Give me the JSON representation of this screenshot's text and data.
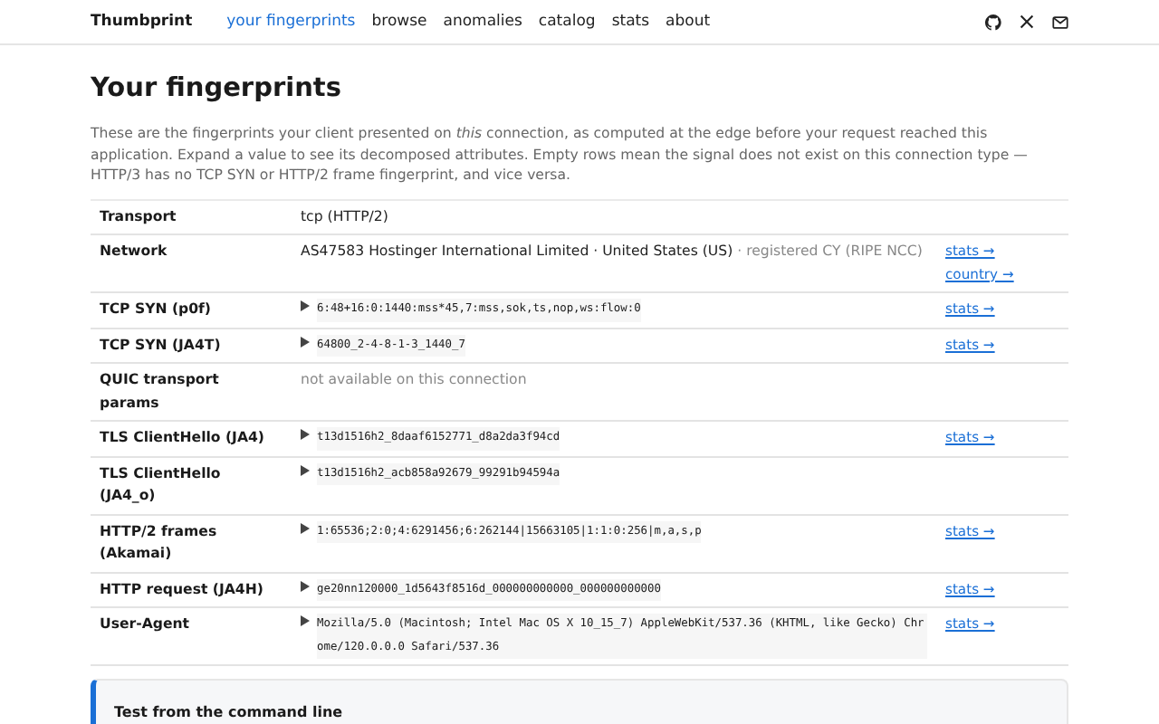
{
  "nav": {
    "brand": "Thumbprint",
    "links": [
      {
        "label": "your fingerprints",
        "selected": true
      },
      {
        "label": "browse",
        "selected": false
      },
      {
        "label": "anomalies",
        "selected": false
      },
      {
        "label": "catalog",
        "selected": false
      },
      {
        "label": "stats",
        "selected": false
      },
      {
        "label": "about",
        "selected": false
      }
    ]
  },
  "title": "Your fingerprints",
  "intro": "These are the fingerprints your client presented on *this* connection, as computed at the edge before your request reached this application. Expand a value to see its decomposed attributes. Empty rows mean the signal does not exist on this connection type — HTTP/3 has no TCP SYN or HTTP/2 frame fingerprint, and vice versa.",
  "rows": [
    {
      "label": "Transport",
      "kind": "text",
      "value": "tcp (HTTP/2)",
      "links": []
    },
    {
      "label": "Network",
      "kind": "text",
      "value": "AS47583 Hostinger International Limited · United States (US)",
      "note": "· registered CY (RIPE NCC)",
      "links": [
        "stats →",
        "country →"
      ]
    },
    {
      "label": "TCP SYN (p0f)",
      "kind": "code",
      "expanded": false,
      "value": "6:48+16:0:1440:mss*45,7:mss,sok,ts,nop,ws:flow:0",
      "links": [
        "stats →"
      ]
    },
    {
      "label": "TCP SYN (JA4T)",
      "kind": "code",
      "expanded": false,
      "value": "64800_2-4-8-1-3_1440_7",
      "links": [
        "stats →"
      ]
    },
    {
      "label": "QUIC transport params",
      "kind": "muted",
      "value": "not available on this connection",
      "links": []
    },
    {
      "label": "TLS ClientHello (JA4)",
      "kind": "code",
      "expanded": false,
      "value": "t13d1516h2_8daaf6152771_d8a2da3f94cd",
      "links": [
        "stats →"
      ]
    },
    {
      "label": "TLS ClientHello (JA4_o)",
      "kind": "code",
      "expanded": false,
      "value": "t13d1516h2_acb858a92679_99291b94594a",
      "links": []
    },
    {
      "label": "HTTP/2 frames (Akamai)",
      "kind": "code",
      "expanded": false,
      "value": "1:65536;2:0;4:6291456;6:262144|15663105|1:1:0:256|m,a,s,p",
      "links": [
        "stats →"
      ]
    },
    {
      "label": "HTTP request (JA4H)",
      "kind": "code",
      "expanded": false,
      "value": "ge20nn120000_1d5643f8516d_000000000000_000000000000",
      "links": [
        "stats →"
      ]
    },
    {
      "label": "User-Agent",
      "kind": "code",
      "expanded": false,
      "value": "Mozilla/5.0 (Macintosh; Intel Mac OS X 10_15_7) AppleWebKit/537.36 (KHTML, like Gecko) Chrome/120.0.0.0 Safari/537.36",
      "links": [
        "stats →"
      ]
    }
  ],
  "cli_card": {
    "title": "Test from the command line"
  }
}
